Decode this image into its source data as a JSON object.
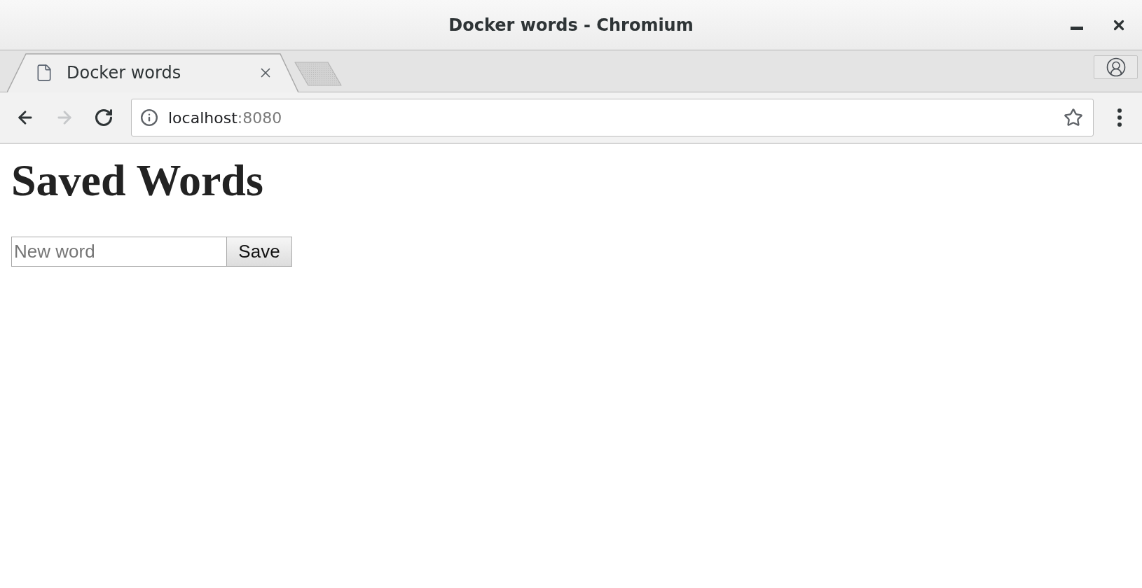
{
  "window": {
    "title": "Docker words - Chromium"
  },
  "tabs": [
    {
      "title": "Docker words",
      "selected": true
    }
  ],
  "toolbar": {
    "back": {
      "disabled": false
    },
    "forward": {
      "disabled": true
    }
  },
  "address_bar": {
    "host": "localhost",
    "port": ":8080"
  },
  "page": {
    "heading": "Saved Words",
    "word_input": {
      "placeholder": "New word"
    },
    "save_button": {
      "label": "Save"
    }
  }
}
